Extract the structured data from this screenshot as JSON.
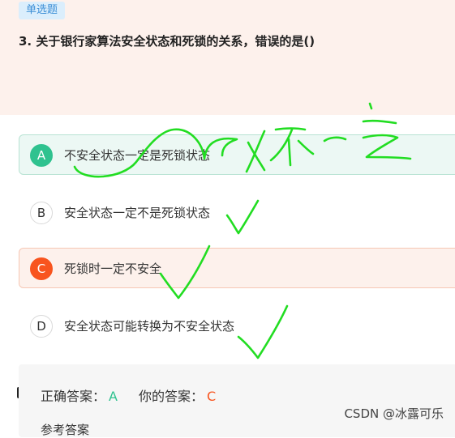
{
  "question": {
    "tag": "单选题",
    "title": "3. 关于银行家算法安全状态和死锁的关系，错误的是()"
  },
  "options": [
    {
      "letter": "A",
      "text": "不安全状态一定是死锁状态",
      "state": "correct"
    },
    {
      "letter": "B",
      "text": "安全状态一定不是死锁状态",
      "state": "normal"
    },
    {
      "letter": "C",
      "text": "死锁时一定不安全",
      "state": "selected-wrong"
    },
    {
      "letter": "D",
      "text": "安全状态可能转换为不安全状态",
      "state": "normal"
    }
  ],
  "answer": {
    "correct_label": "正确答案：",
    "correct_value": "A",
    "yours_label": "你的答案：",
    "yours_value": "C",
    "reference_label": "参考答案"
  },
  "watermark": "CSDN @冰露可乐",
  "annotations": {
    "handwriting": "X不一定",
    "ink_color": "#22dd22"
  },
  "colors": {
    "correct": "#2fc28f",
    "wrong": "#f8541e",
    "tag_bg": "#dbeefc",
    "tag_text": "#3d8fd6",
    "header_bg": "#fdf1ec"
  }
}
